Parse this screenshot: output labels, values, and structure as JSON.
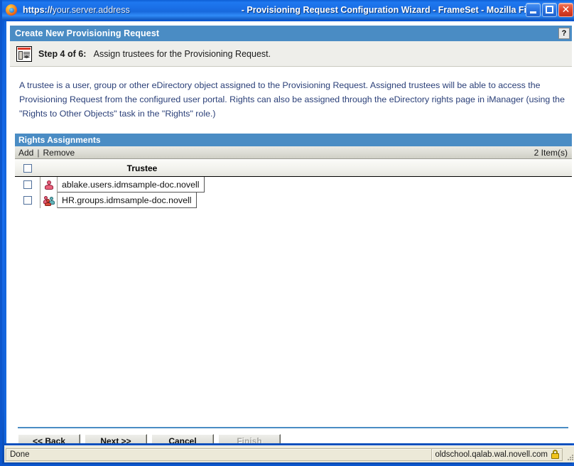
{
  "window": {
    "url_scheme": "https://",
    "url_host": "your.server.address",
    "doc_title": "- Provisioning Request Configuration Wizard - FrameSet - Mozilla Firefox",
    "minimize_label": "Minimize",
    "maximize_label": "Maximize",
    "close_label": "Close",
    "app_icon": "firefox-icon"
  },
  "task": {
    "header_title": "Create New Provisioning Request",
    "help_label": "?",
    "header_color": "#4a8cc4"
  },
  "step": {
    "icon": "wizard-step-icon",
    "label": "Step 4 of 6:",
    "description": "Assign trustees for the Provisioning Request."
  },
  "description": {
    "text": "A trustee is a user, group or other eDirectory object assigned to the Provisioning Request.  Assigned trustees will be able to access the Provisioning Request from the configured user portal.  Rights can also be assigned through the eDirectory rights page in iManager (using the \"Rights to Other Objects\" task in the \"Rights\" role.)",
    "color": "#2a3f78"
  },
  "rights_assignments": {
    "panel_title": "Rights Assignments",
    "toolbar": {
      "add_label": "Add",
      "separator": "|",
      "remove_label": "Remove",
      "count_label": "2 Item(s)"
    },
    "table": {
      "columns": [
        "",
        "",
        "Trustee"
      ],
      "header_checkbox_checked": false,
      "rows": [
        {
          "checked": false,
          "icon": "user-icon",
          "name": "ablake.users.idmsample-doc.novell"
        },
        {
          "checked": false,
          "icon": "group-icon",
          "name": "HR.groups.idmsample-doc.novell"
        }
      ]
    }
  },
  "buttons": [
    {
      "label": "<< Back",
      "name": "back-button",
      "disabled": false
    },
    {
      "label": "Next >>",
      "name": "next-button",
      "disabled": false
    },
    {
      "label": "Cancel",
      "name": "cancel-button",
      "disabled": false
    },
    {
      "label": "Finish",
      "name": "finish-button",
      "disabled": true
    }
  ],
  "statusbar": {
    "status_text": "Done",
    "server_text": "oldschool.qalab.wal.novell.com",
    "lock_icon": "secure-lock-icon"
  }
}
